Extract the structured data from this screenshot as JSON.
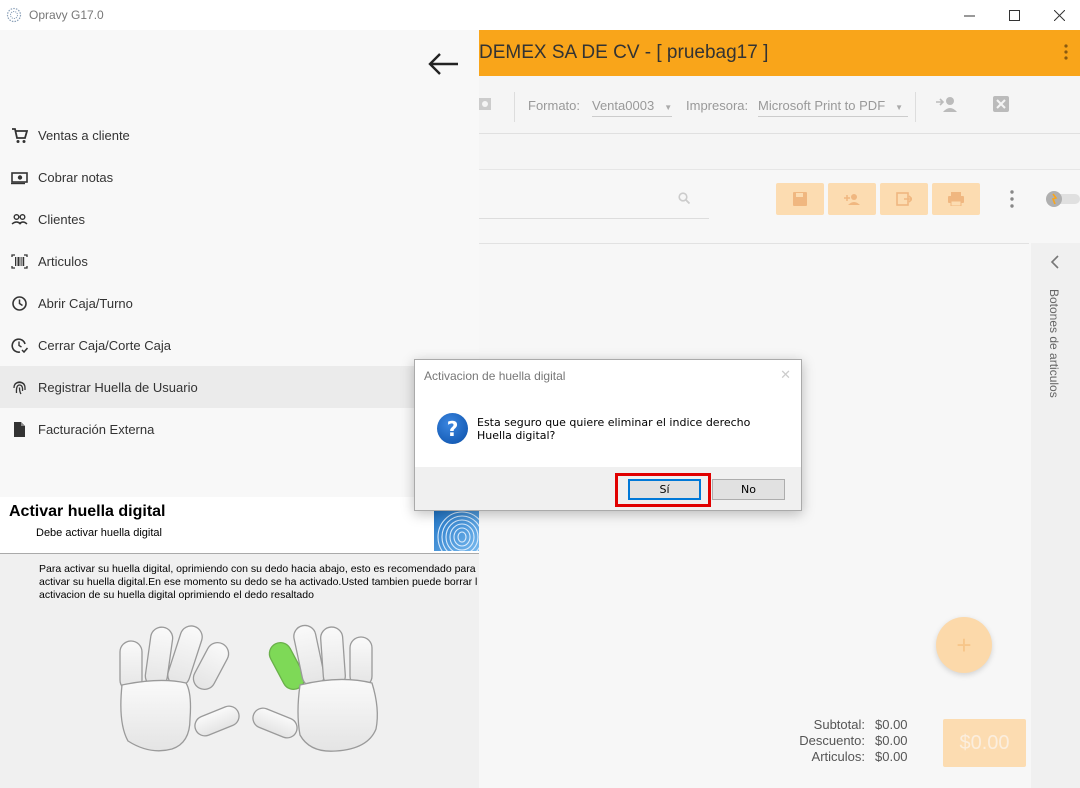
{
  "window": {
    "title": "Opravy G17.0"
  },
  "header": {
    "company": "DEMEX SA DE CV - [ pruebag17 ]"
  },
  "toolbar": {
    "formato_label": "Formato:",
    "formato_value": "Venta0003",
    "impresora_label": "Impresora:",
    "impresora_value": "Microsoft Print to PDF"
  },
  "side_panel": {
    "label": "Botones de articulos"
  },
  "totals": {
    "subtotal_label": "Subtotal:",
    "subtotal_value": "$0.00",
    "descuento_label": "Descuento:",
    "descuento_value": "$0.00",
    "articulos_label": "Articulos:",
    "articulos_value": "$0.00",
    "total_button": "$0.00"
  },
  "menu": {
    "items": [
      {
        "label": "Ventas a cliente",
        "icon": "cart-icon"
      },
      {
        "label": "Cobrar notas",
        "icon": "cash-icon"
      },
      {
        "label": "Clientes",
        "icon": "people-icon"
      },
      {
        "label": "Articulos",
        "icon": "barcode-icon"
      },
      {
        "label": "Abrir Caja/Turno",
        "icon": "clock-icon"
      },
      {
        "label": "Cerrar Caja/Corte Caja",
        "icon": "clock-check-icon"
      },
      {
        "label": "Registrar Huella de Usuario",
        "icon": "fingerprint-icon",
        "active": true
      },
      {
        "label": "Facturación Externa",
        "icon": "document-icon"
      }
    ]
  },
  "fingerprint": {
    "title": "Activar huella digital",
    "subtitle": "Debe activar huella digital",
    "description": "Para activar su huella digital, oprimiendo con su dedo hacia abajo, esto es recomendado para\nactivar su huella digital.En ese momento su dedo se ha activado.Usted tambien puede borrar l\nactivacion de su huella digital oprimiendo el dedo resaltado",
    "highlight_color": "#7ed957"
  },
  "dialog": {
    "title": "Activacion de huella digital",
    "message": "Esta seguro que quiere eliminar el indice derecho Huella digital?",
    "yes_label": "Sí",
    "no_label": "No"
  },
  "colors": {
    "accent": "#f9a51a",
    "highlight_box": "#e00000"
  }
}
